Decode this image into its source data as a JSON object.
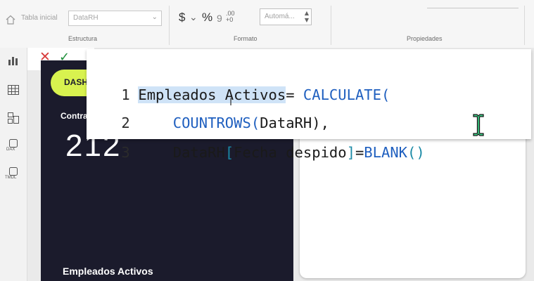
{
  "ribbon": {
    "tabla_label": "Tabla inicial",
    "table_select_value": "DataRH",
    "format_currency": "$",
    "format_dropdown": "⌄",
    "format_percent": "%",
    "format_comma": "9",
    "format_decimals": ".00 +0",
    "auto_value": "Automá...",
    "groups": {
      "structure": "Estructura",
      "format": "Formato",
      "properties": "Propiedades"
    }
  },
  "rail": {
    "items": [
      {
        "icon": "report-view-icon",
        "label": ""
      },
      {
        "icon": "table-view-icon",
        "label": ""
      },
      {
        "icon": "model-view-icon",
        "label": ""
      },
      {
        "icon": "dax-query-icon",
        "label": "DAX"
      },
      {
        "icon": "tmdl-view-icon",
        "label": "TMDL"
      }
    ]
  },
  "formula_bar": {
    "cancel_symbol": "✕",
    "commit_symbol": "✓",
    "line1_num": "1",
    "lines": [
      {
        "num": "1",
        "parts": [
          "Empleados Activos",
          "= ",
          "CALCULATE",
          "("
        ]
      },
      {
        "num": "2",
        "parts": [
          "COUNTROWS",
          "(",
          "DataRH",
          "),"
        ]
      },
      {
        "num": "3",
        "parts": [
          "DataRH",
          "[",
          "Fecha despido",
          "]",
          "=",
          "BLANK",
          "()"
        ]
      }
    ]
  },
  "dashboard": {
    "pill": "DASH",
    "contract_label": "Contra",
    "big_number": "212",
    "bottom_label": "Empleados Activos",
    "pill_color": "#d8f24f",
    "bg_color": "#1b1b2c"
  }
}
